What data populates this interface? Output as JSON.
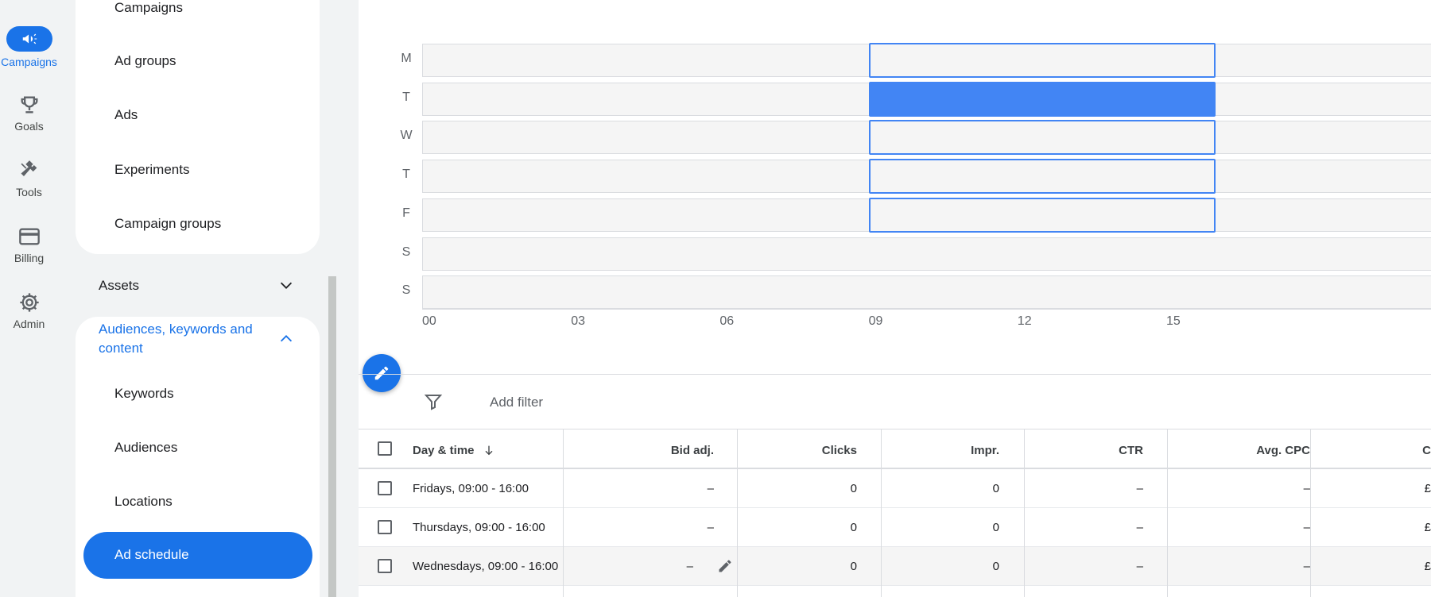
{
  "rail": [
    {
      "label": "Campaigns",
      "icon": "megaphone-icon",
      "active": true
    },
    {
      "label": "Goals",
      "icon": "trophy-icon",
      "active": false
    },
    {
      "label": "Tools",
      "icon": "tools-icon",
      "active": false
    },
    {
      "label": "Billing",
      "icon": "credit-card-icon",
      "active": false
    },
    {
      "label": "Admin",
      "icon": "gear-icon",
      "active": false
    }
  ],
  "nav": {
    "campaign_items": [
      "Campaigns",
      "Ad groups",
      "Ads",
      "Experiments",
      "Campaign groups"
    ],
    "assets_label": "Assets",
    "audiences_label": "Audiences, keywords and content",
    "audience_items": [
      "Keywords",
      "Audiences",
      "Locations"
    ],
    "active_item": "Ad schedule"
  },
  "schedule": {
    "days": [
      "M",
      "T",
      "W",
      "T",
      "F",
      "S",
      "S"
    ],
    "hours": [
      "00",
      "03",
      "06",
      "09",
      "12",
      "15"
    ],
    "slot_days": [
      0,
      1,
      2,
      3,
      4
    ],
    "slot_start_hour": 9,
    "slot_end_hour": 16,
    "selected_day_index": 1,
    "accent_color": "#4285f4"
  },
  "toolbar": {
    "add_filter": "Add filter"
  },
  "table": {
    "headers": {
      "day_time": "Day & time",
      "bid_adj": "Bid adj.",
      "clicks": "Clicks",
      "impr": "Impr.",
      "ctr": "CTR",
      "avg_cpc": "Avg. CPC",
      "cost": "C"
    },
    "rows": [
      {
        "day_time": "Fridays, 09:00 - 16:00",
        "bid_adj": "–",
        "clicks": "0",
        "impr": "0",
        "ctr": "–",
        "avg_cpc": "–",
        "cost": "£"
      },
      {
        "day_time": "Thursdays, 09:00 - 16:00",
        "bid_adj": "–",
        "clicks": "0",
        "impr": "0",
        "ctr": "–",
        "avg_cpc": "–",
        "cost": "£"
      },
      {
        "day_time": "Wednesdays, 09:00 - 16:00",
        "bid_adj": "–",
        "clicks": "0",
        "impr": "0",
        "ctr": "–",
        "avg_cpc": "–",
        "cost": "£"
      }
    ]
  },
  "colors": {
    "primary": "#1a73e8",
    "slot": "#4285f4"
  }
}
